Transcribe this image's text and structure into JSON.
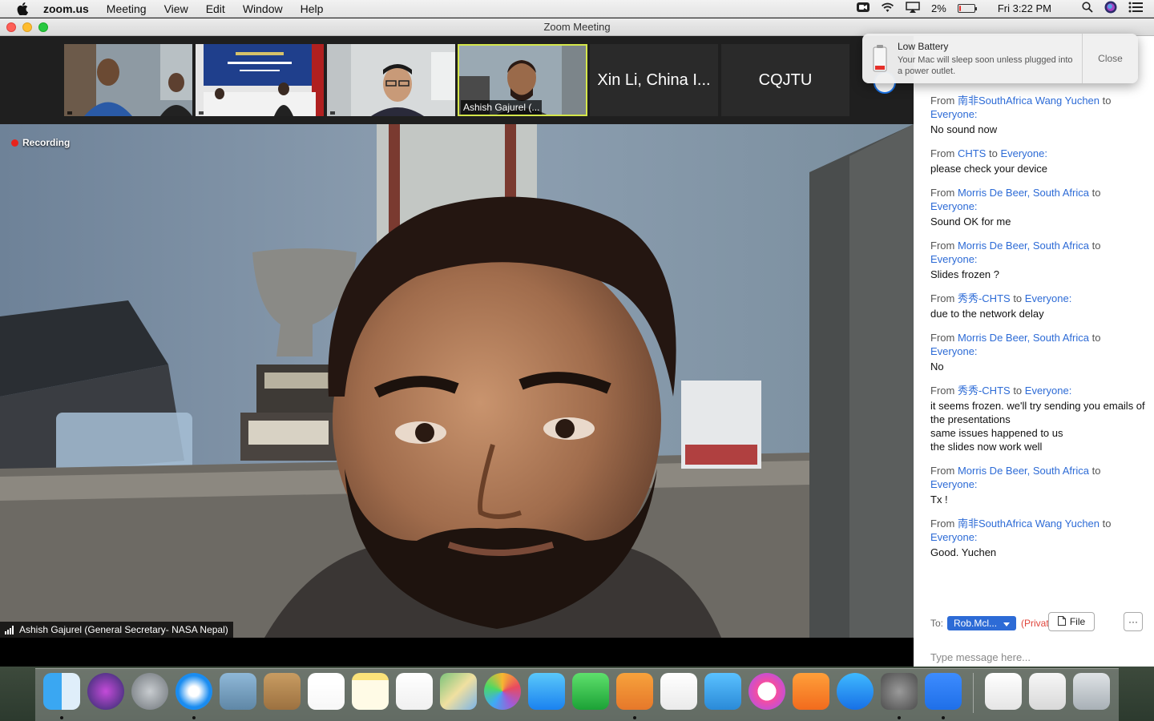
{
  "menubar": {
    "app": "zoom.us",
    "items": [
      "Meeting",
      "View",
      "Edit",
      "Window",
      "Help"
    ],
    "battery_percent": "2%",
    "battery_level": 0.02,
    "clock": "Fri 3:22 PM"
  },
  "window": {
    "title": "Zoom Meeting"
  },
  "thumbnails": [
    {
      "name": ""
    },
    {
      "name": ""
    },
    {
      "name": ""
    },
    {
      "name": "Ashish Gajurel (..."
    },
    {
      "name": "Xin Li, China I..."
    },
    {
      "name": "CQJTU"
    }
  ],
  "main_video": {
    "recording_label": "Recording",
    "speaker": "Ashish Gajurel (General Secretary- NASA Nepal)"
  },
  "notification": {
    "title": "Low Battery",
    "message": "Your Mac will sleep soon unless plugged into a power outlet.",
    "close_label": "Close"
  },
  "chat": {
    "messages": [
      {
        "from_word": "From",
        "from": "南非SouthAfrica Wang Yuchen",
        "to_word": "to",
        "to": "Everyone:",
        "text": "No sound now"
      },
      {
        "from_word": "From",
        "from": "CHTS",
        "to_word": "to",
        "to": "Everyone:",
        "text": "please check your device"
      },
      {
        "from_word": "From",
        "from": "Morris De Beer, South Africa",
        "to_word": "to",
        "to": "Everyone:",
        "text": "Sound OK for me"
      },
      {
        "from_word": "From",
        "from": "Morris De Beer, South Africa",
        "to_word": "to",
        "to": "Everyone:",
        "text": "Slides frozen ?"
      },
      {
        "from_word": "From",
        "from": "秀秀-CHTS",
        "to_word": "to",
        "to": "Everyone:",
        "text": "due to the network delay"
      },
      {
        "from_word": "From",
        "from": "Morris De Beer, South Africa",
        "to_word": "to",
        "to": "Everyone:",
        "text": "No"
      },
      {
        "from_word": "From",
        "from": "秀秀-CHTS",
        "to_word": "to",
        "to": "Everyone:",
        "text": "it seems frozen. we'll try sending you emails of the presentations\nsame issues happened to us\nthe slides now work well"
      },
      {
        "from_word": "From",
        "from": "Morris De Beer, South Africa",
        "to_word": "to",
        "to": "Everyone:",
        "text": "Tx !"
      },
      {
        "from_word": "From",
        "from": "南非SouthAfrica Wang Yuchen",
        "to_word": "to",
        "to": "Everyone:",
        "text": "Good. Yuchen"
      }
    ],
    "to_label": "To:",
    "recipient": "Rob.Mcl...",
    "privately": "(Privately)",
    "file_label": "File",
    "more_label": "···",
    "input_placeholder": "Type message here..."
  },
  "colors": {
    "accent_blue": "#2d6bd6",
    "private_red": "#e0443a",
    "active_thumb": "#d4e64a"
  }
}
